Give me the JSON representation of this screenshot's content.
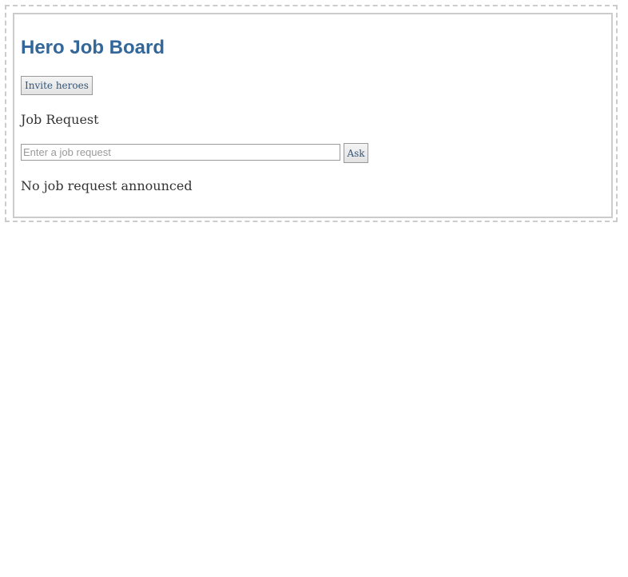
{
  "app": {
    "title": "Hero Job Board"
  },
  "actions": {
    "invite_label": "Invite heroes"
  },
  "job_request": {
    "section_title": "Job Request",
    "input_value": "",
    "input_placeholder": "Enter a job request",
    "ask_label": "Ask",
    "status_text": "No job request announced"
  },
  "colors": {
    "title": "#336699",
    "text": "#333333",
    "border": "#cccccc",
    "button_text": "#335577"
  }
}
